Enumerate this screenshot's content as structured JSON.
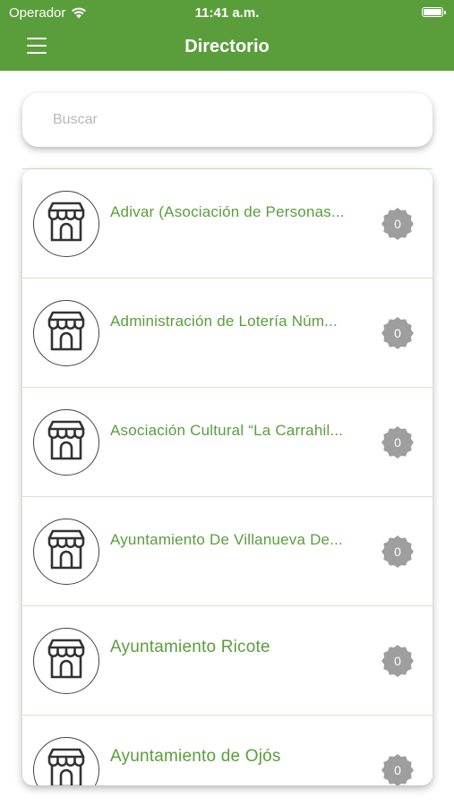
{
  "status_bar": {
    "carrier": "Operador",
    "time": "11:41 a.m."
  },
  "header": {
    "title": "Directorio"
  },
  "search": {
    "placeholder": "Buscar",
    "value": ""
  },
  "colors": {
    "brand_green": "#5a9e3c",
    "badge_gray": "#9e9e9e"
  },
  "items": [
    {
      "title": "Adivar (Asociación de Personas...",
      "count": "0",
      "icon": "shop-icon"
    },
    {
      "title": "Administración de Lotería Núm...",
      "count": "0",
      "icon": "shop-icon"
    },
    {
      "title": "Asociación Cultural “La Carrahil...",
      "count": "0",
      "icon": "shop-icon"
    },
    {
      "title": "Ayuntamiento De Villanueva De...",
      "count": "0",
      "icon": "shop-icon"
    },
    {
      "title": "Ayuntamiento Ricote",
      "count": "0",
      "icon": "shop-icon"
    },
    {
      "title": "Ayuntamiento de Ojós",
      "count": "0",
      "icon": "shop-icon"
    }
  ]
}
